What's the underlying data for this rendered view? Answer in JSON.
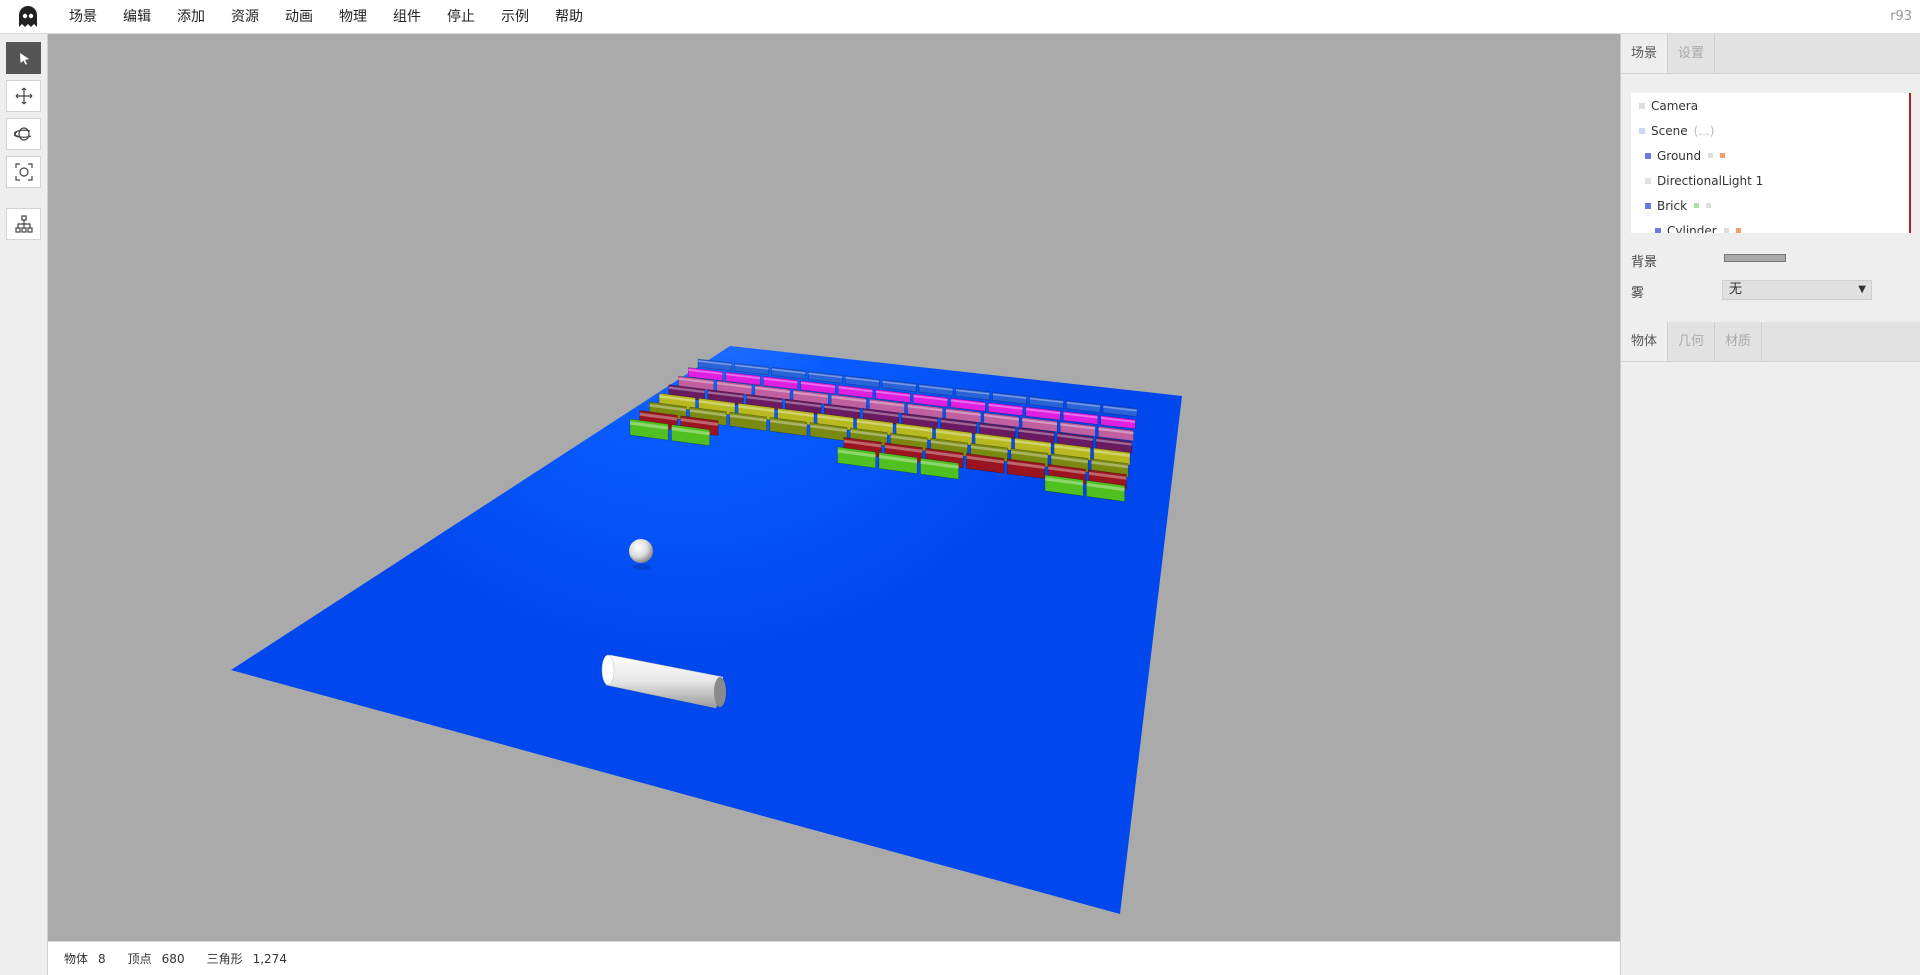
{
  "menubar": {
    "items": [
      "场景",
      "编辑",
      "添加",
      "资源",
      "动画",
      "物理",
      "组件",
      "停止",
      "示例",
      "帮助"
    ],
    "version": "r93"
  },
  "toolbar": {
    "tools": [
      {
        "icon": "select-arrow-icon",
        "active": true
      },
      {
        "icon": "move-icon",
        "active": false
      },
      {
        "icon": "rotate-icon",
        "active": false
      },
      {
        "icon": "scale-icon",
        "active": false
      },
      {
        "icon": "hierarchy-icon",
        "active": false
      }
    ]
  },
  "statusbar": {
    "objects_label": "物体",
    "objects_value": "8",
    "vertices_label": "顶点",
    "vertices_value": "680",
    "triangles_label": "三角形",
    "triangles_value": "1,274"
  },
  "sidebar": {
    "top_tabs": [
      "场景",
      "设置"
    ],
    "outliner": [
      {
        "label": "Camera",
        "extra": ""
      },
      {
        "label": "Scene",
        "extra": "(...)"
      },
      {
        "label": "Ground",
        "extra": ""
      },
      {
        "label": "DirectionalLight 1",
        "extra": ""
      },
      {
        "label": "Brick",
        "extra": ""
      },
      {
        "label": "Cylinder",
        "extra": ""
      }
    ],
    "background_label": "背景",
    "fog_label": "雾",
    "fog_value": "无",
    "bottom_tabs": [
      "物体",
      "几何",
      "材质"
    ]
  },
  "colors": {
    "ground": "#0050ff",
    "background": "#aaaaaa",
    "brick_rows": [
      "#2a62d8",
      "#e020e0",
      "#c060a0",
      "#6a1a60",
      "#b8b820",
      "#7a8a10",
      "#9a1520",
      "#50c020"
    ]
  }
}
